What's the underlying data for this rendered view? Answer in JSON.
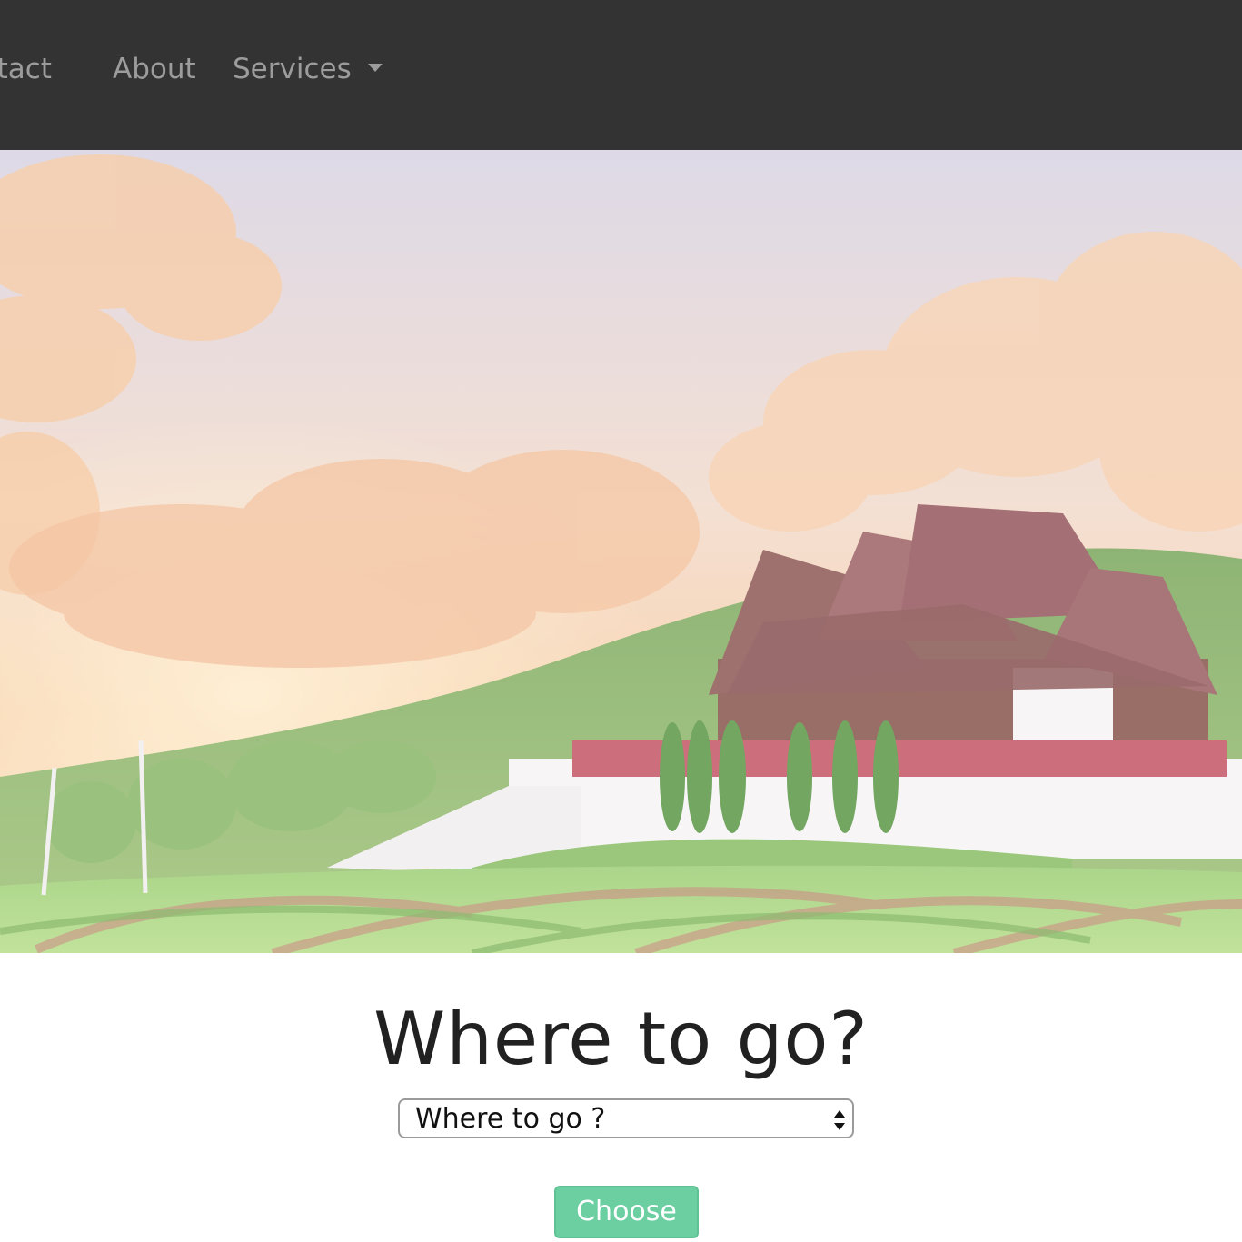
{
  "nav": {
    "items": [
      {
        "label": "ontact"
      },
      {
        "label": "About"
      },
      {
        "label": "Services"
      }
    ],
    "background": "#333333",
    "text_color": "#9c9c9c"
  },
  "hero": {
    "image": "temple-landscape-photo"
  },
  "main": {
    "title": "Where to go?",
    "select": {
      "selected": "Where to go ?"
    },
    "choose_label": "Choose",
    "accent": "#6ccfa2"
  }
}
